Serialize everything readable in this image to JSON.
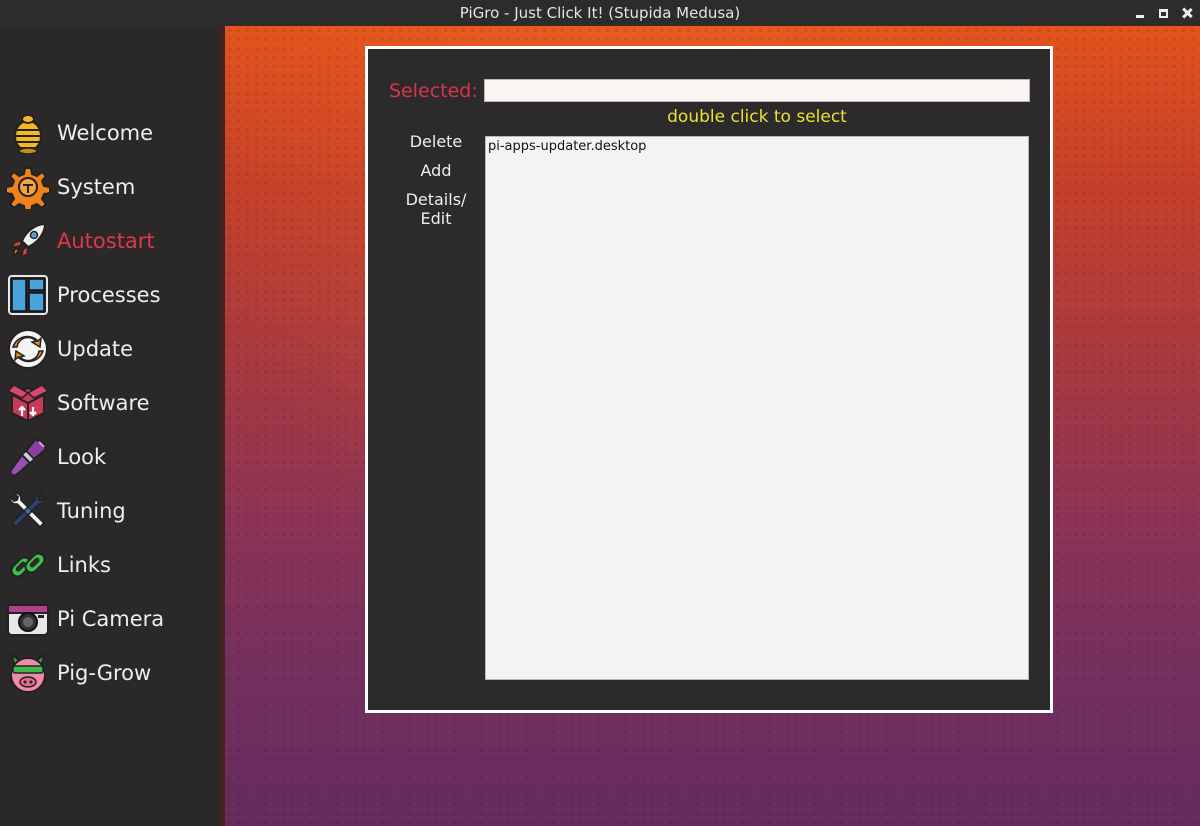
{
  "window": {
    "title": "PiGro - Just Click It! (Stupida Medusa)",
    "controls": [
      "minimize-icon",
      "maximize-icon",
      "close-icon"
    ]
  },
  "sidebar": {
    "active": "Autostart",
    "items": [
      {
        "label": "Welcome",
        "icon": "beehive-icon"
      },
      {
        "label": "System",
        "icon": "gear-icon"
      },
      {
        "label": "Autostart",
        "icon": "rocket-icon"
      },
      {
        "label": "Processes",
        "icon": "grid-icon"
      },
      {
        "label": "Update",
        "icon": "refresh-icon"
      },
      {
        "label": "Software",
        "icon": "package-icon"
      },
      {
        "label": "Look",
        "icon": "paintbrush-icon"
      },
      {
        "label": "Tuning",
        "icon": "wrench-icon"
      },
      {
        "label": "Links",
        "icon": "chain-link-icon"
      },
      {
        "label": "Pi Camera",
        "icon": "camera-icon"
      },
      {
        "label": "Pig-Grow",
        "icon": "pig-icon"
      }
    ]
  },
  "autostart": {
    "selected_label": "Selected:",
    "selected_value": "",
    "hint": "double click to select",
    "actions": {
      "delete": "Delete",
      "add": "Add",
      "details_line1": "Details/",
      "details_line2": "Edit"
    },
    "entries": [
      "pi-apps-updater.desktop"
    ]
  },
  "colors": {
    "accent_active": "#e0374a",
    "hint_yellow": "#e9e233",
    "panel_bg": "#2c2a2a",
    "sidebar_bg": "#2a2828"
  }
}
